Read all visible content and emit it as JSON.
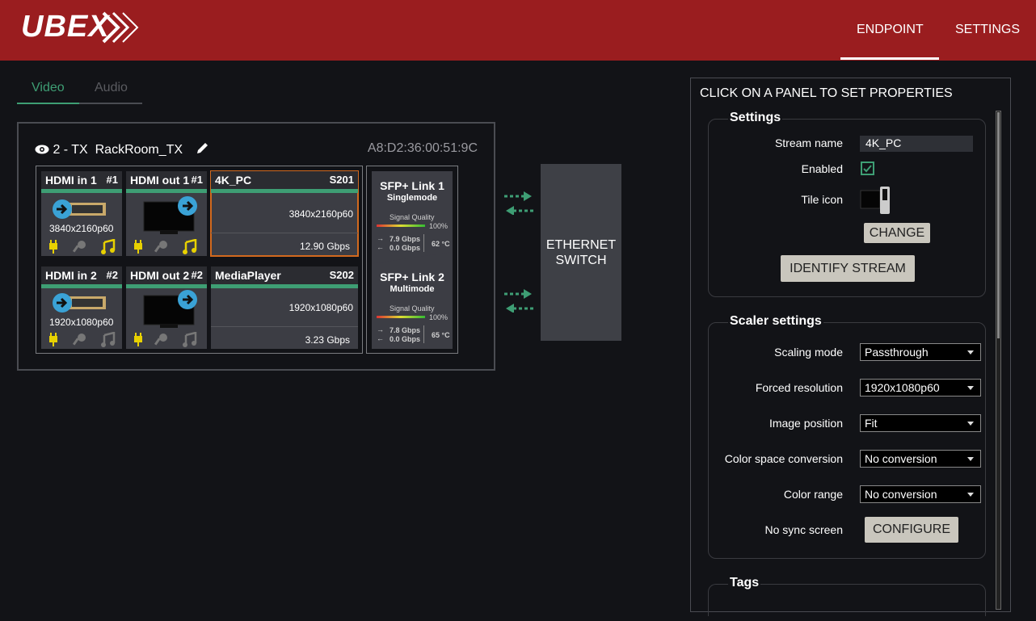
{
  "header": {
    "logo_text": "UBEX",
    "nav": [
      "ENDPOINT",
      "SETTINGS"
    ],
    "active_nav": "ENDPOINT"
  },
  "tabs": [
    {
      "label": "Video",
      "active": true
    },
    {
      "label": "Audio",
      "active": false
    }
  ],
  "device": {
    "name": "2 - TX  RackRoom_TX",
    "mac": "A8:D2:36:00:51:9C",
    "rows": [
      {
        "hdmi_in": {
          "label": "HDMI in 1",
          "num": "#1",
          "resolution": "3840x2160p60"
        },
        "hdmi_out": {
          "label": "HDMI out 1",
          "num": "#1"
        },
        "stream": {
          "label": "4K_PC",
          "id": "S201",
          "resolution": "3840x2160p60",
          "bitrate": "12.90 Gbps",
          "selected": true
        }
      },
      {
        "hdmi_in": {
          "label": "HDMI in 2",
          "num": "#2",
          "resolution": "1920x1080p60"
        },
        "hdmi_out": {
          "label": "HDMI out 2",
          "num": "#2"
        },
        "stream": {
          "label": "MediaPlayer",
          "id": "S202",
          "resolution": "1920x1080p60",
          "bitrate": "3.23 Gbps",
          "selected": false
        }
      }
    ],
    "sfp": [
      {
        "title": "SFP+ Link 1",
        "mode": "Singlemode",
        "signal_label": "Signal Quality",
        "signal_value": "100%",
        "tx": "7.9 Gbps",
        "rx": "0.0 Gbps",
        "temp": "62 °C"
      },
      {
        "title": "SFP+ Link 2",
        "mode": "Multimode",
        "signal_label": "Signal Quality",
        "signal_value": "100%",
        "tx": "7.8 Gbps",
        "rx": "0.0 Gbps",
        "temp": "65 °C"
      }
    ]
  },
  "switch": {
    "line1": "ETHERNET",
    "line2": "SWITCH"
  },
  "properties": {
    "title": "CLICK ON A PANEL TO SET PROPERTIES",
    "settings": {
      "legend": "Settings",
      "stream_name_label": "Stream name",
      "stream_name_value": "4K_PC",
      "enabled_label": "Enabled",
      "tile_icon_label": "Tile icon",
      "change_button": "CHANGE",
      "identify_button": "IDENTIFY STREAM"
    },
    "scaler": {
      "legend": "Scaler settings",
      "fields": [
        {
          "label": "Scaling mode",
          "value": "Passthrough"
        },
        {
          "label": "Forced resolution",
          "value": "1920x1080p60"
        },
        {
          "label": "Image position",
          "value": "Fit"
        },
        {
          "label": "Color space conversion",
          "value": "No conversion"
        },
        {
          "label": "Color range",
          "value": "No conversion"
        }
      ],
      "no_sync_label": "No sync screen",
      "configure_button": "CONFIGURE"
    },
    "tags": {
      "legend": "Tags"
    }
  },
  "colors": {
    "header": "#9a1d1f",
    "accent": "#3e9e74",
    "selected": "#d2691e",
    "audio_active": "#e8d100"
  }
}
